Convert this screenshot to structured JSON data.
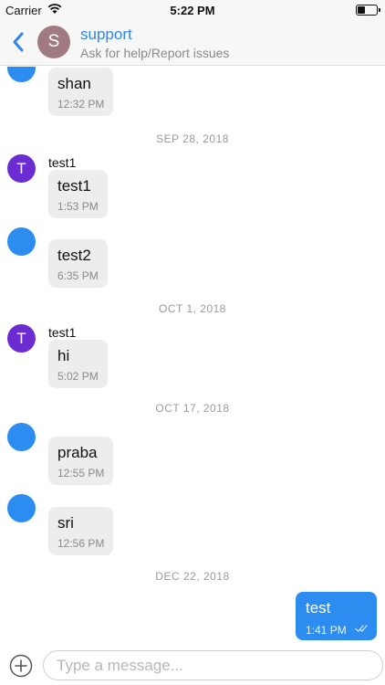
{
  "status_bar": {
    "carrier": "Carrier",
    "time": "5:22 PM",
    "battery_level": 0.4
  },
  "header": {
    "avatar_letter": "S",
    "title": "support",
    "subtitle": "Ask for help/Report issues"
  },
  "messages": [
    {
      "type": "in",
      "avatar": "blue",
      "text": "shan",
      "time": "12:32 PM"
    },
    {
      "type": "date",
      "label": "SEP 28, 2018"
    },
    {
      "type": "in",
      "avatar": "purple",
      "avatar_letter": "T",
      "sender": "test1",
      "text": "test1",
      "time": "1:53 PM"
    },
    {
      "type": "in",
      "avatar": "blue",
      "text": "test2",
      "time": "6:35 PM"
    },
    {
      "type": "date",
      "label": "OCT 1, 2018"
    },
    {
      "type": "in",
      "avatar": "purple",
      "avatar_letter": "T",
      "sender": "test1",
      "text": "hi",
      "time": "5:02 PM"
    },
    {
      "type": "date",
      "label": "OCT 17, 2018"
    },
    {
      "type": "in",
      "avatar": "blue",
      "text": "praba",
      "time": "12:55 PM"
    },
    {
      "type": "in",
      "avatar": "blue",
      "text": "sri",
      "time": "12:56 PM"
    },
    {
      "type": "date",
      "label": "DEC 22, 2018"
    },
    {
      "type": "out",
      "text": "test",
      "time": "1:41 PM"
    }
  ],
  "composer": {
    "placeholder": "Type a message..."
  },
  "colors": {
    "accent": "#2f86eb",
    "bubble_in": "#ededed",
    "bubble_out": "#2d8cf0",
    "avatar_blue": "#2d8cf0",
    "avatar_purple": "#6b2dd1"
  }
}
